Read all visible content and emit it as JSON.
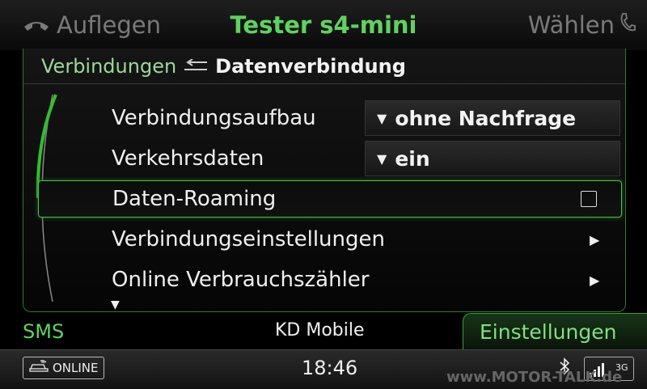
{
  "topbar": {
    "left_label": "Auflegen",
    "title": "Tester s4-mini",
    "right_label": "Wählen"
  },
  "breadcrumb": {
    "parent": "Verbindungen",
    "current": "Datenverbindung"
  },
  "rows": [
    {
      "label": "Verbindungsaufbau",
      "value": "ohne Nachfrage",
      "control": "select"
    },
    {
      "label": "Verkehrsdaten",
      "value": "ein",
      "control": "select"
    },
    {
      "label": "Daten-Roaming",
      "checked": false,
      "control": "checkbox",
      "selected": true
    },
    {
      "label": "Verbindungseinstellungen",
      "control": "submenu"
    },
    {
      "label": "Online Verbrauchszähler",
      "control": "submenu"
    }
  ],
  "tabs": {
    "left": "SMS",
    "center": "KD Mobile",
    "right": "Einstellungen"
  },
  "statusbar": {
    "online_label": "ONLINE",
    "time": "18:46",
    "network": "3G"
  },
  "watermark": "www.MOTOR-TALK.de",
  "colors": {
    "accent": "#5fd35f",
    "selection_border": "#49c449",
    "background": "#000000"
  }
}
